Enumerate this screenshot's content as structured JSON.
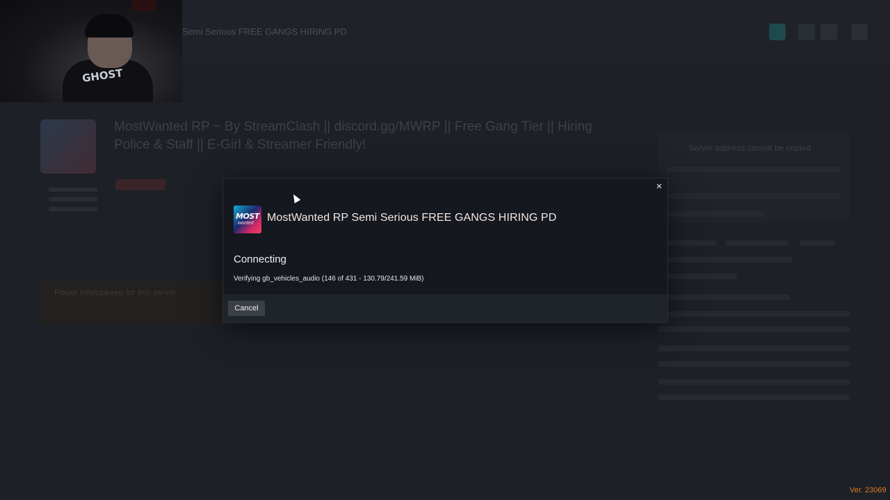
{
  "background": {
    "breadcrumb": "Semi Serious FREE GANGS HIRING PD",
    "server_title": "MostWanted RP ~ By StreamClash || discord.gg/MWRP || Free Gang Tier || Hiring Police & Staff || E-Girl & Streamer Friendly!",
    "notice_title": "Player info/upkeep for this server",
    "side_text": "Server address cannot be copied"
  },
  "dialog": {
    "server_icon_text": "MOST",
    "server_icon_sub": "wanted",
    "server_name": "MostWanted RP Semi Serious FREE GANGS HIRING PD",
    "status": "Connecting",
    "progress_text": "Verifying gb_vehicles_audio (146 of 431 - 130.79/241.59 MiB)",
    "cancel_label": "Cancel",
    "close_label": "×"
  },
  "webcam": {
    "shirt_text": "GHOST"
  },
  "version": "Ver. 23069",
  "colors": {
    "accent_version": "#e07a22",
    "dialog_bg": "#15181e",
    "footer_bg": "#1f232a"
  }
}
